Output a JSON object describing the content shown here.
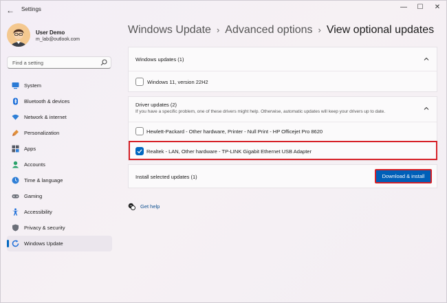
{
  "window": {
    "title": "Settings"
  },
  "profile": {
    "name": "User Demo",
    "email": "m_lab@outlook.com"
  },
  "search": {
    "placeholder": "Find a setting"
  },
  "sidebar": {
    "items": [
      {
        "label": "System",
        "icon": "system-icon",
        "color": "#2a7ad5"
      },
      {
        "label": "Bluetooth & devices",
        "icon": "bluetooth-icon",
        "color": "#1e6fd9"
      },
      {
        "label": "Network & internet",
        "icon": "wifi-icon",
        "color": "#2f7fd6"
      },
      {
        "label": "Personalization",
        "icon": "brush-icon",
        "color": "#e08f3a"
      },
      {
        "label": "Apps",
        "icon": "apps-icon",
        "color": "#555a66"
      },
      {
        "label": "Accounts",
        "icon": "accounts-icon",
        "color": "#2aa36b"
      },
      {
        "label": "Time & language",
        "icon": "globe-clock-icon",
        "color": "#2f7fd6"
      },
      {
        "label": "Gaming",
        "icon": "gamepad-icon",
        "color": "#6b6f78"
      },
      {
        "label": "Accessibility",
        "icon": "accessibility-icon",
        "color": "#1e6fd9"
      },
      {
        "label": "Privacy & security",
        "icon": "shield-icon",
        "color": "#6b6f78"
      },
      {
        "label": "Windows Update",
        "icon": "windows-update-icon",
        "color": "#1e6fd9",
        "active": true
      }
    ]
  },
  "breadcrumb": {
    "item1": "Windows Update",
    "item2": "Advanced options",
    "current": "View optional updates"
  },
  "windows_updates": {
    "header": "Windows updates (1)",
    "items": [
      {
        "label": "Windows 11, version 22H2",
        "checked": false
      }
    ]
  },
  "driver_updates": {
    "header": "Driver updates (2)",
    "description": "If you have a specific problem, one of these drivers might help. Otherwise, automatic updates will keep your drivers up to date.",
    "items": [
      {
        "label": "Hewlett-Packard  - Other hardware, Printer - Null Print - HP Officejet Pro 8620",
        "checked": false
      },
      {
        "label": "Realtek - LAN, Other hardware - TP-LINK Gigabit Ethernet USB Adapter",
        "checked": true
      }
    ]
  },
  "install": {
    "label": "Install selected updates (1)",
    "button": "Download & install"
  },
  "help": {
    "label": "Get help"
  },
  "colors": {
    "accent": "#0067c0",
    "highlight": "#d61f26"
  }
}
